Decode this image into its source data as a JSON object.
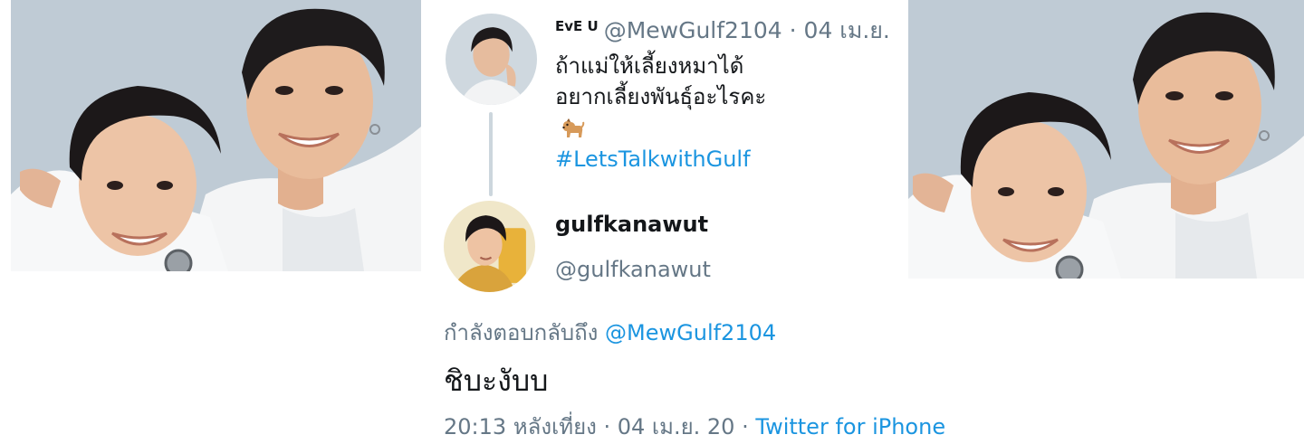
{
  "photos": {
    "left": {
      "description_icon": "couple-photo"
    },
    "right": {
      "description_icon": "couple-photo"
    }
  },
  "parent_tweet": {
    "display_name": "EvE U",
    "handle": "@MewGulf2104",
    "separator": "·",
    "date": "04 เม.ย.",
    "text_line1": "ถ้าแม่ให้เลี้ยงหมาได้",
    "text_line2": "อยากเลี้ยงพันธุ์อะไรคะ",
    "emoji_icon": "dog-icon",
    "hashtag": "#LetsTalkwithGulf"
  },
  "reply_tweet": {
    "display_name": "gulfkanawut",
    "handle": "@gulfkanawut",
    "replying_to_label": "กำลังตอบกลับถึง",
    "replying_to_handle": "@MewGulf2104",
    "text": "ชิบะงับบ",
    "time": "20:13 หลังเที่ยง",
    "separator": "·",
    "date": "04 เม.ย. 20",
    "source": "Twitter for iPhone"
  },
  "colors": {
    "link": "#1b95e0",
    "secondary_text": "#657786",
    "primary_text": "#14171a",
    "thread_line": "#ccd6dd"
  }
}
